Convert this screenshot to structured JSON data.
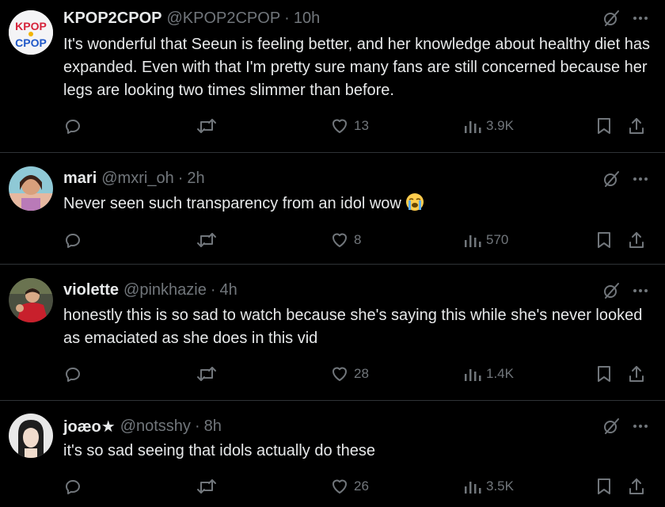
{
  "colors": {
    "background": "#000000",
    "text_primary": "#e7e9ea",
    "text_secondary": "#71767b",
    "divider": "#2f3336"
  },
  "tweets": [
    {
      "display_name": "KPOP2CPOP",
      "handle": "@KPOP2CPOP",
      "separator": "·",
      "time": "10h",
      "avatar_text_top": "KPOP",
      "avatar_text_bottom": "CPOP",
      "text": "It's wonderful that Seeun is feeling better, and her knowledge about healthy diet has expanded. Even with that I'm pretty sure many fans are still concerned because her legs are looking two times slimmer than before.",
      "likes": "13",
      "views": "3.9K"
    },
    {
      "display_name": "mari",
      "handle": "@mxri_oh",
      "separator": "·",
      "time": "2h",
      "text": "Never seen such transparency from an idol wow",
      "emoji": "loudly-crying-face",
      "likes": "8",
      "views": "570"
    },
    {
      "display_name": "violette",
      "handle": "@pinkhazie",
      "separator": "·",
      "time": "4h",
      "text": "honestly this is so sad to watch because she's saying this while she's never looked as emaciated as she does in this vid",
      "likes": "28",
      "views": "1.4K"
    },
    {
      "display_name": "joæo★",
      "handle": "@notsshy",
      "separator": "·",
      "time": "8h",
      "text": "it's so sad seeing that idols actually do these",
      "likes": "26",
      "views": "3.5K"
    }
  ],
  "icons": {
    "grok": "grok-icon",
    "more": "more-icon",
    "reply": "reply-icon",
    "repost": "repost-icon",
    "like": "heart-icon",
    "views": "views-icon",
    "bookmark": "bookmark-icon",
    "share": "share-icon"
  }
}
